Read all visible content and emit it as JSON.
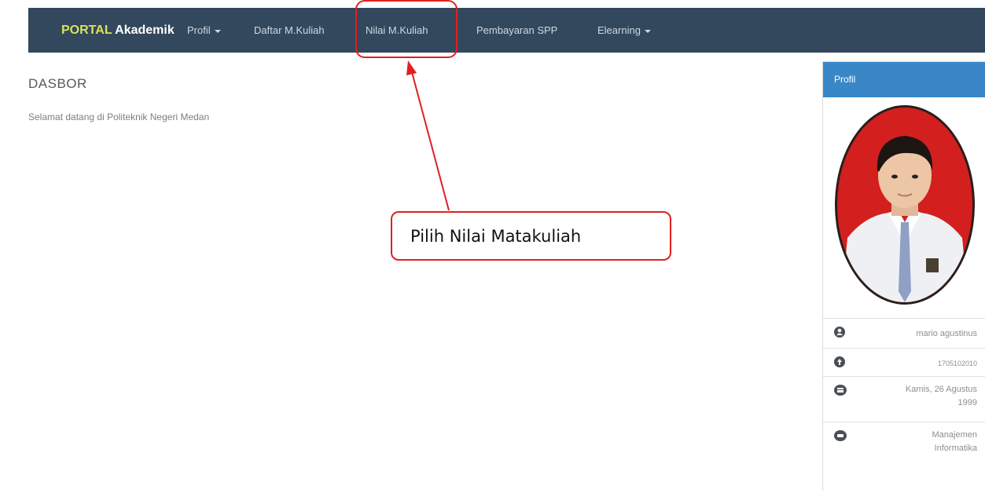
{
  "navbar": {
    "brand_part1": "PORTAL",
    "brand_part2": "Akademik",
    "items": [
      {
        "label": "Profil",
        "dropdown": true
      },
      {
        "label": "Daftar M.Kuliah",
        "dropdown": false
      },
      {
        "label": "Nilai M.Kuliah",
        "dropdown": false
      },
      {
        "label": "Pembayaran SPP",
        "dropdown": false
      },
      {
        "label": "Elearning",
        "dropdown": true
      }
    ]
  },
  "main": {
    "title": "DASBOR",
    "welcome": "Selamat datang di Politeknik Negeri Medan"
  },
  "profile": {
    "header": "Profil",
    "rows": [
      {
        "icon": "user-icon",
        "line1": "mario agustinus",
        "line2": ""
      },
      {
        "icon": "id-icon",
        "line1": "1705102010",
        "line2": ""
      },
      {
        "icon": "calendar-icon",
        "line1": "Kamis, 26 Agustus",
        "line2": "1999"
      },
      {
        "icon": "chat-icon",
        "line1": "Manajemen",
        "line2": "Informatika"
      }
    ]
  },
  "annotation": {
    "callout_text": "Pilih Nilai Matakuliah"
  },
  "colors": {
    "navbar": "#33485c",
    "brand_accent": "#d7e35a",
    "panel_header": "#3a87c8",
    "annotation": "#e02020"
  }
}
